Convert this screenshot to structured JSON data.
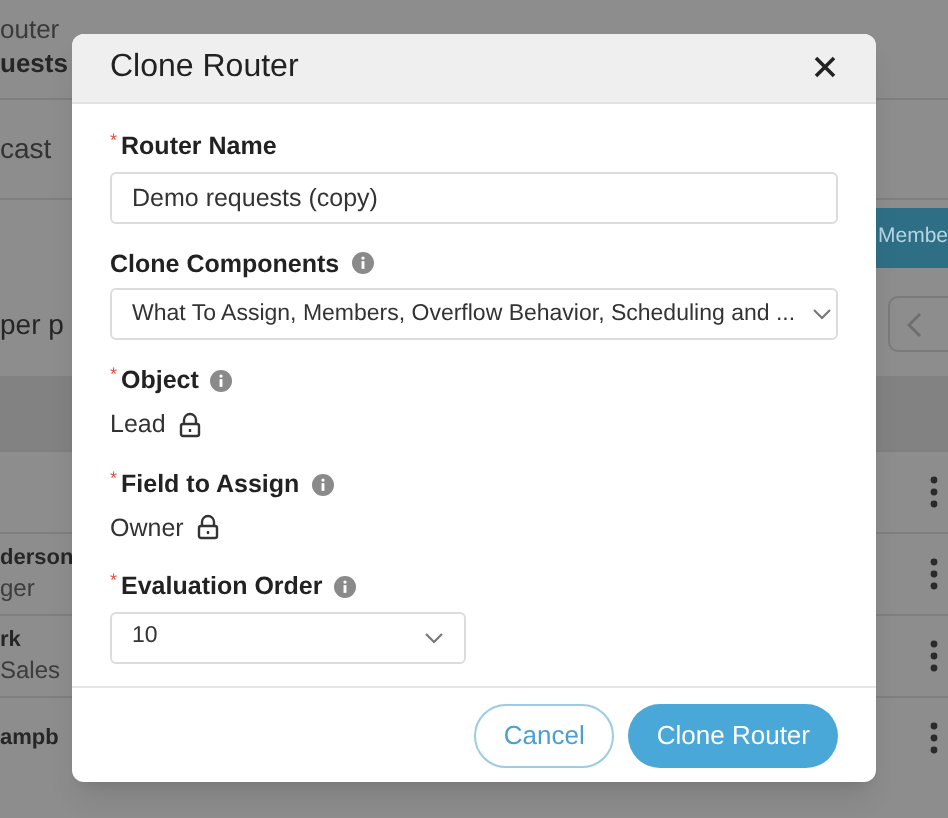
{
  "background": {
    "breadcrumb": "outer",
    "title": "uests",
    "tab": "cast",
    "action_button": "Membe",
    "per_page": "per p",
    "rows": [
      {},
      {
        "name": "derson",
        "subtitle": "ger"
      },
      {
        "name": "rk",
        "subtitle": "Sales"
      },
      {
        "name": "ampb"
      }
    ]
  },
  "dialog": {
    "title": "Clone Router",
    "fields": [
      {
        "kind": "text",
        "label": "Router Name",
        "required_mark": "*",
        "info": false,
        "value": "Demo requests (copy)"
      },
      {
        "kind": "select",
        "label": "Clone Components",
        "info": true,
        "value": "What To Assign, Members, Overflow Behavior, Scheduling and ..."
      },
      {
        "kind": "locked",
        "label": "Object",
        "required_mark": "*",
        "info": true,
        "value": "Lead"
      },
      {
        "kind": "locked",
        "label": "Field to Assign",
        "required_mark": "*",
        "info": true,
        "value": "Owner"
      },
      {
        "kind": "short-select",
        "label": "Evaluation Order",
        "required_mark": "*",
        "info": true,
        "value": "10"
      }
    ],
    "buttons": [
      {
        "label": "Cancel",
        "kind": "secondary"
      },
      {
        "label": "Clone Router",
        "kind": "primary"
      }
    ]
  }
}
